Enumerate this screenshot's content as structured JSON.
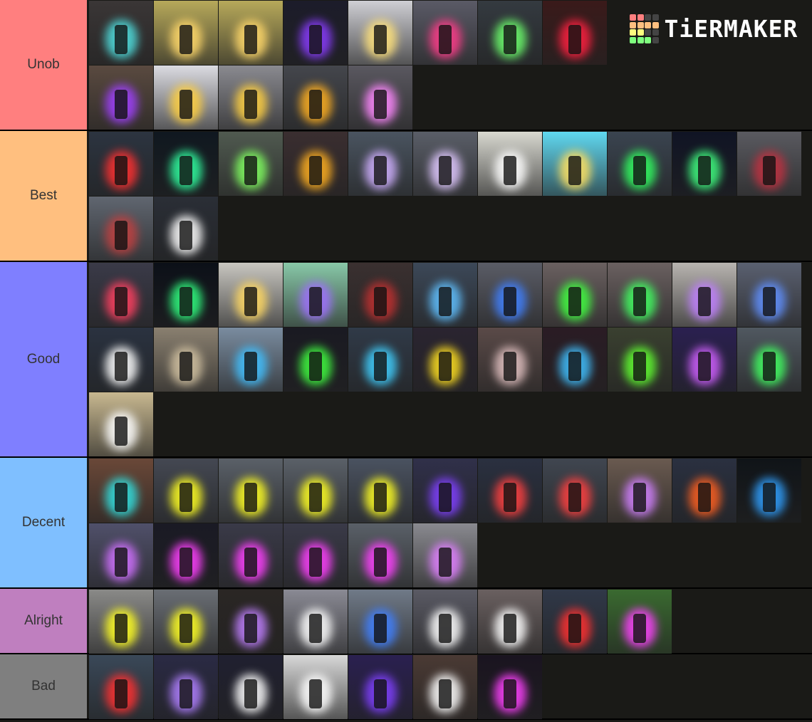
{
  "logo": {
    "text": "TiERMAKER",
    "grid_colors": [
      "#ff7f7f",
      "#ff7f7f",
      "#444444",
      "#444444",
      "#ffbf7f",
      "#ffbf7f",
      "#ffbf7f",
      "#ffbf7f",
      "#ffff7f",
      "#ffff7f",
      "#444444",
      "#444444",
      "#7fff7f",
      "#7fff7f",
      "#7fff7f",
      "#444444"
    ]
  },
  "tiers": [
    {
      "label": "Unob",
      "color": "#ff7f7f",
      "rows": 2,
      "tiles": [
        {
          "bg": "#3a3636",
          "glow": "#4fe0e0"
        },
        {
          "bg": "#b7a95a",
          "glow": "#ffd86a"
        },
        {
          "bg": "#b7a95a",
          "glow": "#ffd86a"
        },
        {
          "bg": "#1c1c2a",
          "glow": "#8a3cff"
        },
        {
          "bg": "#cfcfd4",
          "glow": "#ffe27a"
        },
        {
          "bg": "#5a5a66",
          "glow": "#ff3c8a"
        },
        {
          "bg": "#343a40",
          "glow": "#6cff6c"
        },
        {
          "bg": "#3a1a1a",
          "glow": "#ff2040"
        },
        {
          "bg": "#5a4a40",
          "glow": "#a040ff"
        },
        {
          "bg": "#dcdce2",
          "glow": "#ffd040"
        },
        {
          "bg": "#8a8a90",
          "glow": "#ffd040"
        },
        {
          "bg": "#44464c",
          "glow": "#ffb020"
        },
        {
          "bg": "#5a5860",
          "glow": "#ff88ff"
        }
      ]
    },
    {
      "label": "Best",
      "color": "#ffbf7f",
      "rows": 2,
      "tiles": [
        {
          "bg": "#2c3440",
          "glow": "#ff3030"
        },
        {
          "bg": "#101820",
          "glow": "#30ffa0"
        },
        {
          "bg": "#505a50",
          "glow": "#80ff60"
        },
        {
          "bg": "#3a2e30",
          "glow": "#ffb020"
        },
        {
          "bg": "#4a5460",
          "glow": "#d0b0ff"
        },
        {
          "bg": "#5a5e68",
          "glow": "#e0c8ff"
        },
        {
          "bg": "#d8d8d0",
          "glow": "#ffffff"
        },
        {
          "bg": "#60d8f0",
          "glow": "#ffe060"
        },
        {
          "bg": "#3a4450",
          "glow": "#30ff60"
        },
        {
          "bg": "#101424",
          "glow": "#40ff80"
        },
        {
          "bg": "#5a5a60",
          "glow": "#c03040"
        },
        {
          "bg": "#606670",
          "glow": "#c04040"
        },
        {
          "bg": "#2a2e36",
          "glow": "#ffffff"
        }
      ]
    },
    {
      "label": "Good",
      "color": "#7f7fff",
      "rows": 3,
      "tiles": [
        {
          "bg": "#3a3a48",
          "glow": "#ff4060"
        },
        {
          "bg": "#0c1018",
          "glow": "#30ff80"
        },
        {
          "bg": "#c8c6c0",
          "glow": "#ffd860"
        },
        {
          "bg": "#88c8a8",
          "glow": "#a070ff"
        },
        {
          "bg": "#3a3030",
          "glow": "#c03030"
        },
        {
          "bg": "#3c4858",
          "glow": "#60c0ff"
        },
        {
          "bg": "#5a5c66",
          "glow": "#4080ff"
        },
        {
          "bg": "#6a6060",
          "glow": "#40ff40"
        },
        {
          "bg": "#6a6060",
          "glow": "#40ff60"
        },
        {
          "bg": "#b8b4b0",
          "glow": "#c080ff"
        },
        {
          "bg": "#5a6070",
          "glow": "#6090ff"
        },
        {
          "bg": "#2a3240",
          "glow": "#ffffff"
        },
        {
          "bg": "#8a8070",
          "glow": "#d0c0a0"
        },
        {
          "bg": "#7a8ca0",
          "glow": "#40c0ff"
        },
        {
          "bg": "#1a1a22",
          "glow": "#40ff40"
        },
        {
          "bg": "#303a48",
          "glow": "#40d0ff"
        },
        {
          "bg": "#2a2430",
          "glow": "#ffe020"
        },
        {
          "bg": "#5a4a48",
          "glow": "#e0c0c0"
        },
        {
          "bg": "#2a1c24",
          "glow": "#40c0ff"
        },
        {
          "bg": "#3a4030",
          "glow": "#60ff30"
        },
        {
          "bg": "#2a2050",
          "glow": "#d060ff"
        },
        {
          "bg": "#505860",
          "glow": "#40ff60"
        },
        {
          "bg": "#c8b890",
          "glow": "#ffffff"
        }
      ]
    },
    {
      "label": "Decent",
      "color": "#7fbfff",
      "rows": 2,
      "tiles": [
        {
          "bg": "#6a4838",
          "glow": "#30e0e0"
        },
        {
          "bg": "#444852",
          "glow": "#ffff20"
        },
        {
          "bg": "#5a6068",
          "glow": "#ffff20"
        },
        {
          "bg": "#5a6068",
          "glow": "#ffff20"
        },
        {
          "bg": "#4a5260",
          "glow": "#ffff20"
        },
        {
          "bg": "#30304a",
          "glow": "#8040ff"
        },
        {
          "bg": "#2a3040",
          "glow": "#ff4040"
        },
        {
          "bg": "#404650",
          "glow": "#ff4040"
        },
        {
          "bg": "#6a5a50",
          "glow": "#d080ff"
        },
        {
          "bg": "#2a3040",
          "glow": "#ff6020"
        },
        {
          "bg": "#101418",
          "glow": "#30a0ff"
        },
        {
          "bg": "#50506a",
          "glow": "#d070ff"
        },
        {
          "bg": "#1a1a24",
          "glow": "#ff40ff"
        },
        {
          "bg": "#3a3a48",
          "glow": "#ff40ff"
        },
        {
          "bg": "#3a3a48",
          "glow": "#ff40ff"
        },
        {
          "bg": "#5a6068",
          "glow": "#ff40ff"
        },
        {
          "bg": "#8a8a90",
          "glow": "#e080ff"
        }
      ]
    },
    {
      "label": "Alright",
      "color": "#bf7fbf",
      "rows": 1,
      "tiles": [
        {
          "bg": "#8a8a88",
          "glow": "#ffff20"
        },
        {
          "bg": "#6a6e74",
          "glow": "#ffff20"
        },
        {
          "bg": "#2a2624",
          "glow": "#c080ff"
        },
        {
          "bg": "#8a8a94",
          "glow": "#ffffff"
        },
        {
          "bg": "#707a88",
          "glow": "#4080ff"
        },
        {
          "bg": "#5a5a64",
          "glow": "#ffffff"
        },
        {
          "bg": "#6a6060",
          "glow": "#ffffff"
        },
        {
          "bg": "#303848",
          "glow": "#ff3030"
        },
        {
          "bg": "#3a6a30",
          "glow": "#ff40ff"
        }
      ]
    },
    {
      "label": "Bad",
      "color": "#7f7f7f",
      "rows": 1,
      "tiles": [
        {
          "bg": "#3a4858",
          "glow": "#ff3030"
        },
        {
          "bg": "#2a2a44",
          "glow": "#b080ff"
        },
        {
          "bg": "#202030",
          "glow": "#ffffff"
        },
        {
          "bg": "#d8d8d8",
          "glow": "#ffffff"
        },
        {
          "bg": "#2a2050",
          "glow": "#8040ff"
        },
        {
          "bg": "#4a3a34",
          "glow": "#ffffff"
        },
        {
          "bg": "#1a1420",
          "glow": "#ff40ff"
        }
      ]
    }
  ]
}
